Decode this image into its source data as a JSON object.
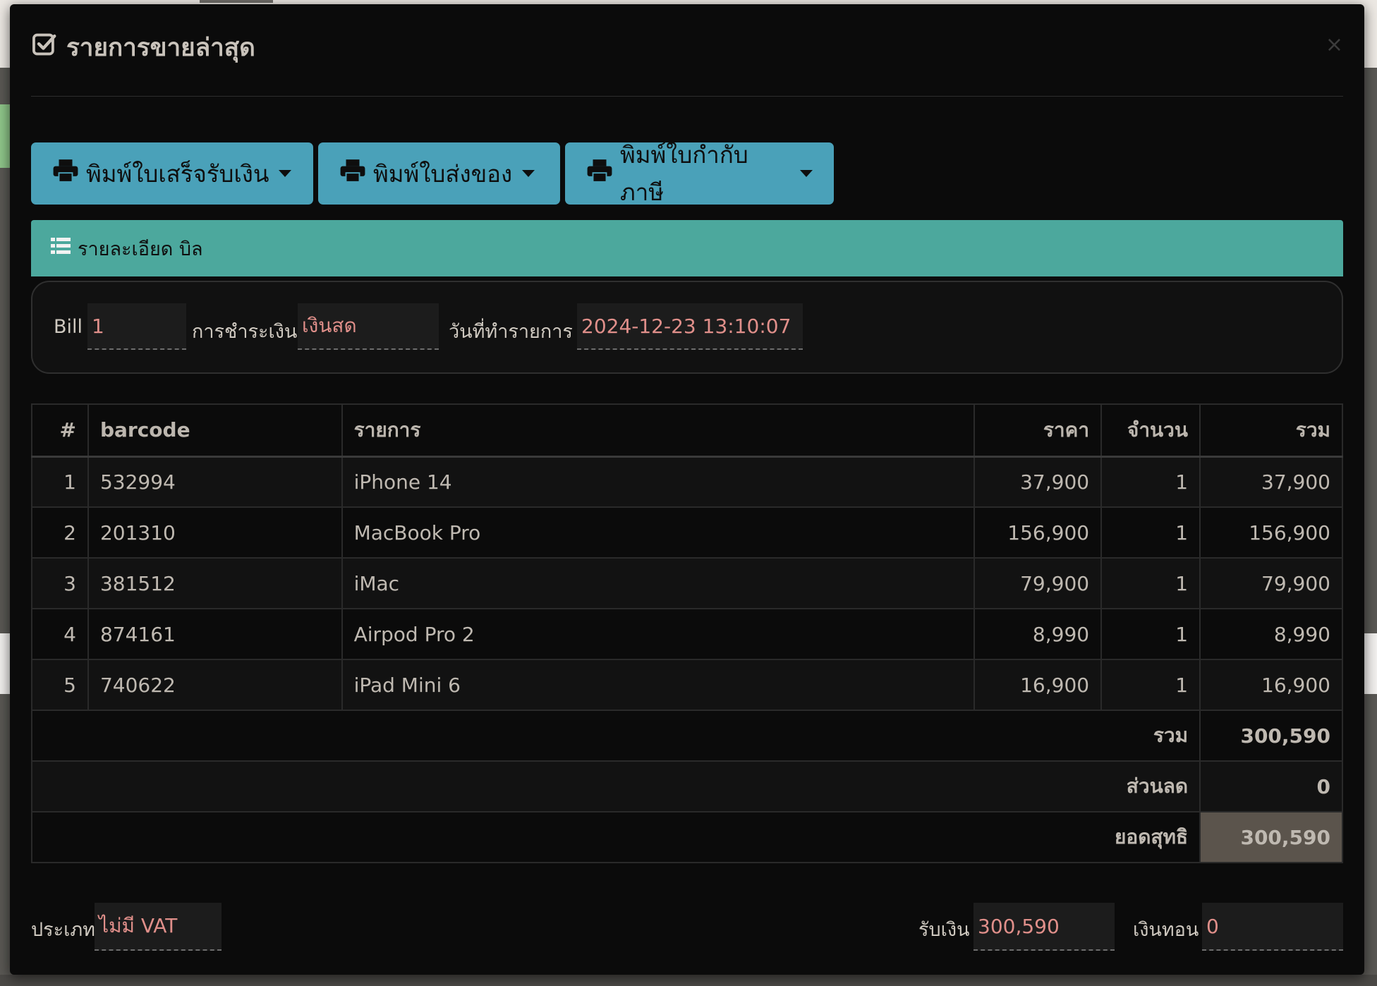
{
  "modal": {
    "title": "รายการขายล่าสุด",
    "close_label": "×"
  },
  "buttons": [
    {
      "label": "พิมพ์ใบเสร็จรับเงิน"
    },
    {
      "label": "พิมพ์ใบส่งของ"
    },
    {
      "label": "พิมพ์ใบกำกับภาษี"
    }
  ],
  "panel": {
    "title": "รายละเอียด บิล",
    "bill_label": "Bill",
    "bill_value": "1",
    "payment_label": "การชำระเงิน",
    "payment_value": "เงินสด",
    "date_label": "วันที่ทำรายการ",
    "date_value": "2024-12-23 13:10:07"
  },
  "table": {
    "headers": [
      "#",
      "barcode",
      "รายการ",
      "ราคา",
      "จำนวน",
      "รวม"
    ],
    "rows": [
      {
        "no": "1",
        "barcode": "532994",
        "item": "iPhone 14",
        "price": "37,900",
        "qty": "1",
        "total": "37,900"
      },
      {
        "no": "2",
        "barcode": "201310",
        "item": "MacBook Pro",
        "price": "156,900",
        "qty": "1",
        "total": "156,900"
      },
      {
        "no": "3",
        "barcode": "381512",
        "item": "iMac",
        "price": "79,900",
        "qty": "1",
        "total": "79,900"
      },
      {
        "no": "4",
        "barcode": "874161",
        "item": "Airpod Pro 2",
        "price": "8,990",
        "qty": "1",
        "total": "8,990"
      },
      {
        "no": "5",
        "barcode": "740622",
        "item": "iPad Mini 6",
        "price": "16,900",
        "qty": "1",
        "total": "16,900"
      }
    ],
    "subtotal_label": "รวม",
    "subtotal": "300,590",
    "discount_label": "ส่วนลด",
    "discount": "0",
    "net_label": "ยอดสุทธิ",
    "net": "300,590"
  },
  "footer": {
    "type_label": "ประเภท",
    "type_value": "ไม่มี VAT",
    "received_label": "รับเงิน",
    "received_value": "300,590",
    "change_label": "เงินทอน",
    "change_value": "0"
  },
  "colors": {
    "primary_button": "#4aa1b9",
    "panel_header": "#4ca89d",
    "value_text": "#e08f8a",
    "net_highlight": "#5b544c"
  }
}
